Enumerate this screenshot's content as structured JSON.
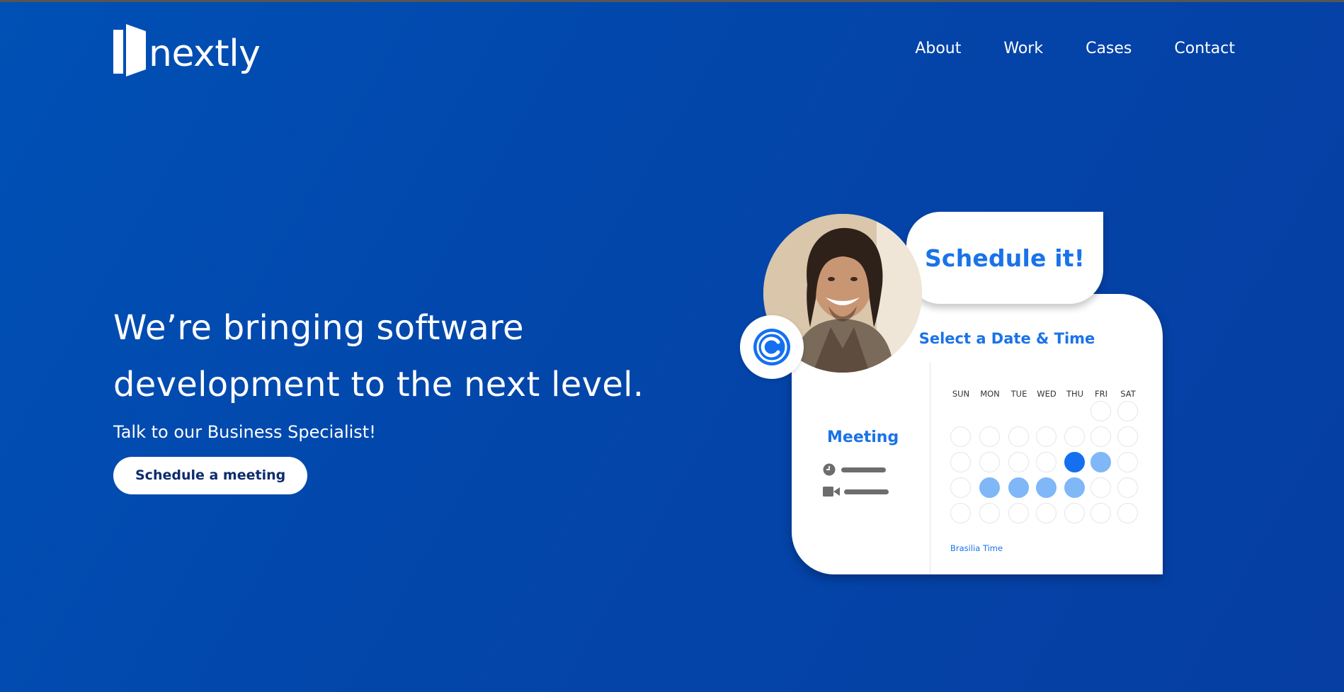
{
  "header": {
    "logo_text": "nextly",
    "nav": [
      "About",
      "Work",
      "Cases",
      "Contact"
    ]
  },
  "hero": {
    "headline_line1": "We’re bringing software",
    "headline_line2": "development to the next level.",
    "subtitle": "Talk to our Business Specialist!",
    "cta_label": "Schedule a meeting"
  },
  "illustration": {
    "bubble_text": "Schedule it!",
    "card_title": "Select a Date & Time",
    "meeting_label": "Meeting",
    "weekdays": [
      "SUN",
      "MON",
      "TUE",
      "WED",
      "THU",
      "FRI",
      "SAT"
    ],
    "timezone": "Brasilia Time",
    "icons": [
      "calendly-logo-icon",
      "clock-icon",
      "video-camera-icon"
    ]
  },
  "colors": {
    "background": "#0443a8",
    "accent": "#1a73e8",
    "selected_day": "#1570f0",
    "available_day": "#7fb7f7",
    "cta_text": "#0d2c6e"
  }
}
